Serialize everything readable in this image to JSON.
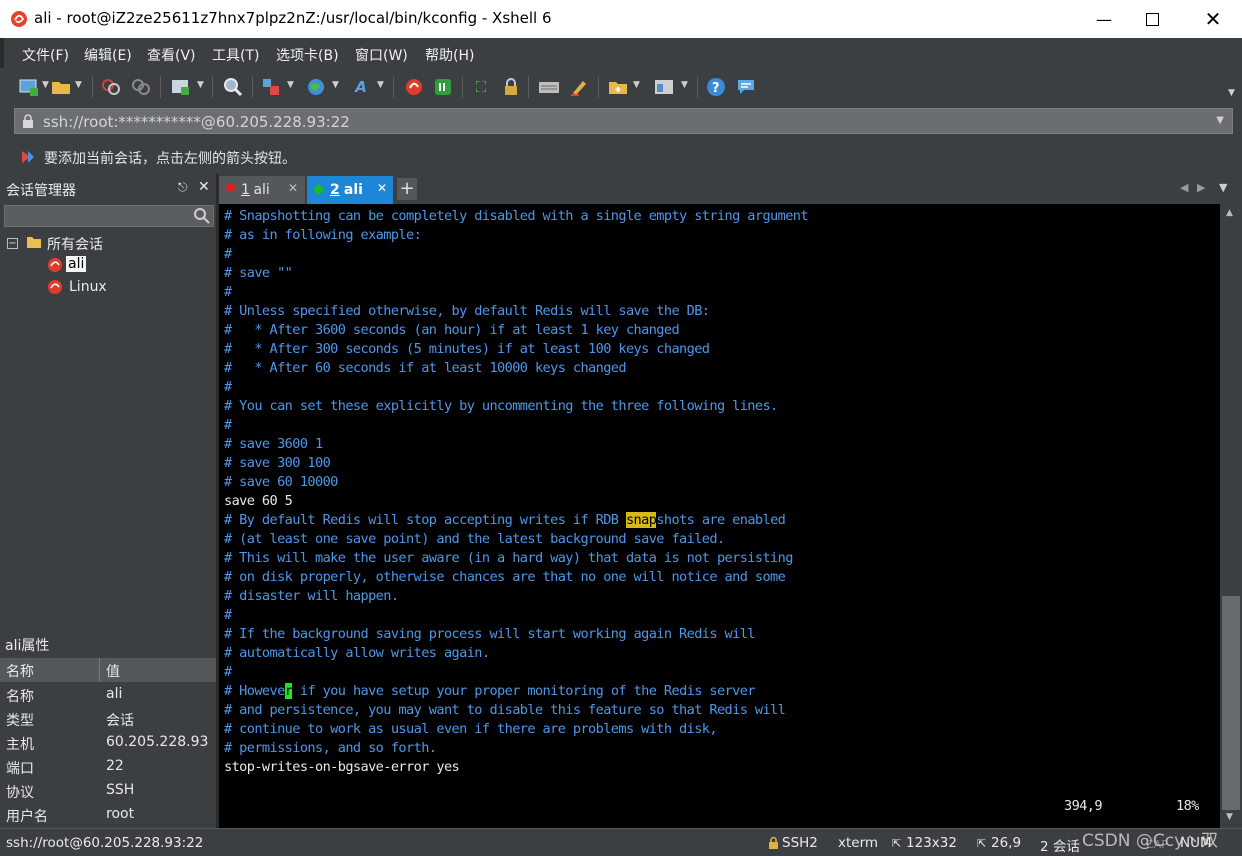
{
  "window": {
    "title": "ali - root@iZ2ze25611z7hnx7plpz2nZ:/usr/local/bin/kconfig - Xshell 6"
  },
  "menu": [
    "文件(F)",
    "编辑(E)",
    "查看(V)",
    "工具(T)",
    "选项卡(B)",
    "窗口(W)",
    "帮助(H)"
  ],
  "address": {
    "value": "ssh://root:***********@60.205.228.93:22"
  },
  "hint": {
    "text": "要添加当前会话，点击左侧的箭头按钮。"
  },
  "session_manager": {
    "title": "会话管理器",
    "search_placeholder": "",
    "tree": {
      "root": "所有会话",
      "items": [
        "ali",
        "Linux"
      ]
    }
  },
  "properties": {
    "title": "ali属性",
    "headers": [
      "名称",
      "值"
    ],
    "rows": [
      [
        "名称",
        "ali"
      ],
      [
        "类型",
        "会话"
      ],
      [
        "主机",
        "60.205.228.93"
      ],
      [
        "端口",
        "22"
      ],
      [
        "协议",
        "SSH"
      ],
      [
        "用户名",
        "root"
      ]
    ]
  },
  "tabs": [
    {
      "num": "1",
      "label": " ali",
      "status_color": "#e02020"
    },
    {
      "num": "2",
      "label": " ali",
      "status_color": "#18c018"
    }
  ],
  "terminal": {
    "lines": [
      {
        "t": "# Snapshotting can be completely disabled with a single empty string argument",
        "c": "cm"
      },
      {
        "t": "# as in following example:",
        "c": "cm"
      },
      {
        "t": "#",
        "c": "cm"
      },
      {
        "t": "# save \"\"",
        "c": "cm"
      },
      {
        "t": "#",
        "c": "cm"
      },
      {
        "t": "# Unless specified otherwise, by default Redis will save the DB:",
        "c": "cm"
      },
      {
        "t": "#   * After 3600 seconds (an hour) if at least 1 key changed",
        "c": "cm"
      },
      {
        "t": "#   * After 300 seconds (5 minutes) if at least 100 keys changed",
        "c": "cm"
      },
      {
        "t": "#   * After 60 seconds if at least 10000 keys changed",
        "c": "cm"
      },
      {
        "t": "#",
        "c": "cm"
      },
      {
        "t": "# You can set these explicitly by uncommenting the three following lines.",
        "c": "cm"
      },
      {
        "t": "#",
        "c": "cm"
      },
      {
        "t": "# save 3600 1",
        "c": "cm"
      },
      {
        "t": "# save 300 100",
        "c": "cm"
      },
      {
        "t": "# save 60 10000",
        "c": "cm"
      },
      {
        "t": "save 60 5",
        "c": "wt"
      },
      {
        "pre": "# By default Redis will stop accepting writes if RDB ",
        "hl": "snap",
        "post": "shots are enabled",
        "c": "cm"
      },
      {
        "t": "# (at least one save point) and the latest background save failed.",
        "c": "cm"
      },
      {
        "t": "# This will make the user aware (in a hard way) that data is not persisting",
        "c": "cm"
      },
      {
        "t": "# on disk properly, otherwise chances are that no one will notice and some",
        "c": "cm"
      },
      {
        "t": "# disaster will happen.",
        "c": "cm"
      },
      {
        "t": "#",
        "c": "cm"
      },
      {
        "t": "# If the background saving process will start working again Redis will",
        "c": "cm"
      },
      {
        "t": "# automatically allow writes again.",
        "c": "cm"
      },
      {
        "t": "#",
        "c": "cm"
      },
      {
        "pre": "# Howeve",
        "cur": "r",
        "post": " if you have setup your proper monitoring of the Redis server",
        "c": "cm"
      },
      {
        "t": "# and persistence, you may want to disable this feature so that Redis will",
        "c": "cm"
      },
      {
        "t": "# continue to work as usual even if there are problems with disk,",
        "c": "cm"
      },
      {
        "t": "# permissions, and so forth.",
        "c": "cm"
      },
      {
        "t": "stop-writes-on-bgsave-error yes",
        "c": "wt"
      }
    ],
    "ruler": {
      "position": "394,9",
      "percent": "18%"
    }
  },
  "status": {
    "left": "ssh://root@60.205.228.93:22",
    "ssh": "SSH2",
    "term": "xterm",
    "size": "123x32",
    "cursor": "26,9",
    "sessions": "2 会话",
    "cap": "CAP",
    "num": "NUM",
    "watermark": "CSDN @Ccy丶双"
  }
}
